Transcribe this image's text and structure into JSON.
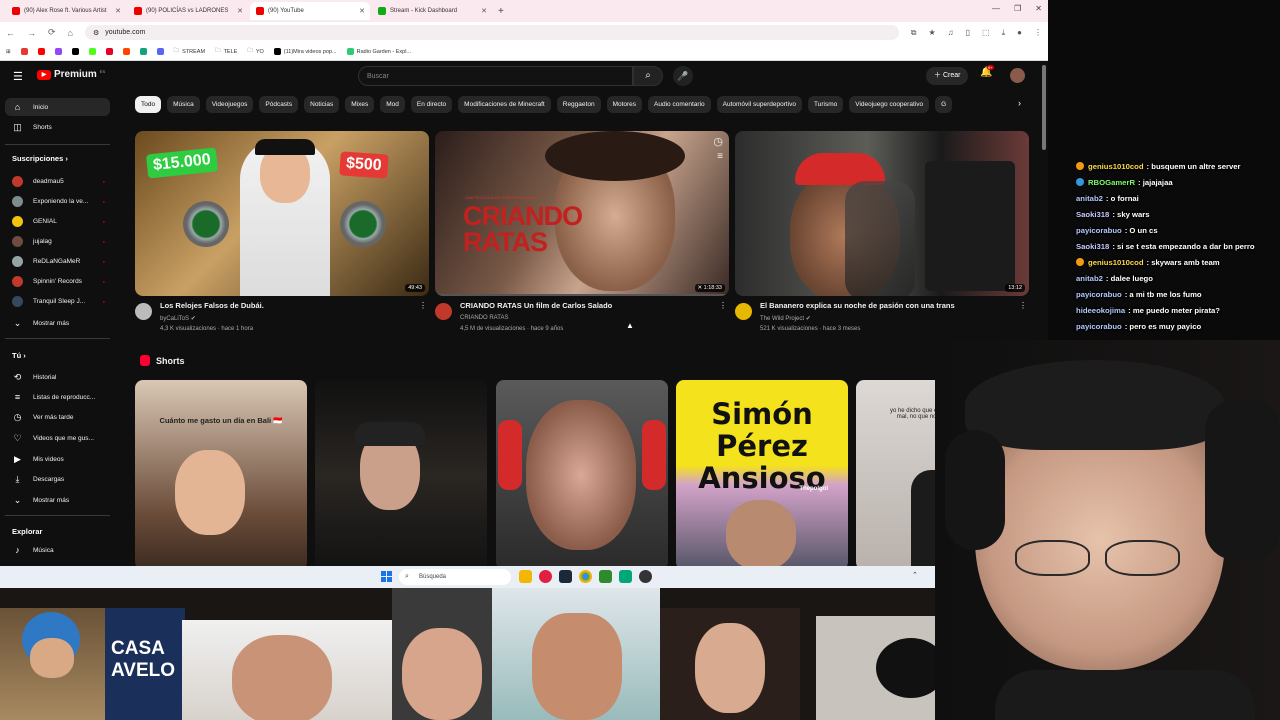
{
  "browser": {
    "tabs": [
      {
        "title": "(90) Alex Rose ft. Various Artist",
        "active": false
      },
      {
        "title": "(90) POLICÍAS vs LADRONES",
        "active": false
      },
      {
        "title": "(90) YouTube",
        "active": true
      },
      {
        "title": "Stream - Kick Dashboard",
        "active": false
      }
    ],
    "new_tab": "+",
    "url": "youtube.com",
    "bookmarks": [
      "STREAM",
      "TELE",
      "YO",
      "(11)Mira videos pop...",
      "Radio Garden - Expl..."
    ]
  },
  "youtube": {
    "logo_text": "Premium",
    "logo_sup": "ES",
    "search_placeholder": "Buscar",
    "create_label": "Crear",
    "notif_count": "9+",
    "sidebar": {
      "main": [
        {
          "label": "Inicio",
          "icon": "home-icon",
          "glyph": "⌂"
        },
        {
          "label": "Shorts",
          "icon": "shorts-icon",
          "glyph": "◫"
        }
      ],
      "subs_header": "Suscripciones",
      "subscriptions": [
        {
          "label": "deadmau5",
          "color": "#c0392b"
        },
        {
          "label": "Exponiendo la ve...",
          "color": "#7f8c8d"
        },
        {
          "label": "GENIAL",
          "color": "#f1c40f"
        },
        {
          "label": "jujalag",
          "color": "#6d4c41"
        },
        {
          "label": "ReDLaNGaMeR",
          "color": "#95a5a6"
        },
        {
          "label": "Spinnin' Records",
          "color": "#c0392b"
        },
        {
          "label": "Tranquil Sleep J...",
          "color": "#34495e"
        }
      ],
      "show_more": "Mostrar más",
      "you_header": "Tú",
      "you_items": [
        {
          "label": "Historial",
          "icon": "history-icon",
          "glyph": "⟲"
        },
        {
          "label": "Listas de reproducc...",
          "icon": "playlists-icon",
          "glyph": "≡"
        },
        {
          "label": "Ver más tarde",
          "icon": "watch-later-icon",
          "glyph": "◷"
        },
        {
          "label": "Videos que me gus...",
          "icon": "like-icon",
          "glyph": "♡"
        },
        {
          "label": "Mis videos",
          "icon": "my-videos-icon",
          "glyph": "▶"
        },
        {
          "label": "Descargas",
          "icon": "download-icon",
          "glyph": "⤓"
        },
        {
          "label": "Mostrar más",
          "icon": "chevron-down-icon",
          "glyph": "⌄"
        }
      ],
      "explore_header": "Explorar",
      "explore_items": [
        {
          "label": "Música",
          "icon": "music-icon",
          "glyph": "♪"
        }
      ]
    },
    "chips": [
      "Todo",
      "Música",
      "Videojuegos",
      "Pódcasts",
      "Noticias",
      "Mixes",
      "Mod",
      "En directo",
      "Modificaciones de Minecraft",
      "Reggaeton",
      "Motores",
      "Audio comentario",
      "Automóvil superdeportivo",
      "Turismo",
      "Videojuego cooperativo",
      "G"
    ],
    "videos": [
      {
        "title": "Los Relojes Falsos de Dubái.",
        "channel": "byCaLiToS",
        "meta": "4,3 K visualizaciones · hace 1 hora",
        "duration": "49:43",
        "badge_left": "$15.000",
        "badge_right": "$500"
      },
      {
        "title": "CRIANDO RATAS Un film de Carlos Salado",
        "channel": "CRIANDO RATAS",
        "meta": "4,5 M de visualizaciones · hace 9 años",
        "duration": "1:18:33",
        "overlay": "CRIANDO RATAS",
        "overlay_small": "UNA PELÍCULA DE CARLOS SALADO"
      },
      {
        "title": "El Bananero explica su noche de pasión con una trans",
        "channel": "The Wild Project",
        "meta": "521 K visualizaciones · hace 3 meses",
        "duration": "13:12"
      }
    ],
    "shorts_title": "Shorts",
    "shorts": [
      {
        "caption": "Cuánto me gasto un día en Bali 🇮🇩"
      },
      {
        "caption": ""
      },
      {
        "caption": ""
      },
      {
        "caption": "Simón Pérez Ansioso",
        "tag": "Thepolgol"
      },
      {
        "caption": "yo he dicho que es idiota y que me cae mal, no que no le tuviera ganas ..."
      }
    ]
  },
  "taskbar": {
    "search_placeholder": "Búsqueda"
  },
  "chat": [
    {
      "user": "genius1010cod",
      "text": ": busquem un altre server",
      "color": "#ffd94a",
      "badge": "#f39c12"
    },
    {
      "user": "RBOGamerR",
      "text": ": jajajajaa",
      "color": "#7cff6b",
      "badge": "#3498db"
    },
    {
      "user": "anitab2",
      "text": ": o fornai",
      "color": "#b3c8ff",
      "badge": ""
    },
    {
      "user": "Saoki318",
      "text": ": sky wars",
      "color": "#c7c9ff",
      "badge": ""
    },
    {
      "user": "payicorabuo",
      "text": ": O un cs",
      "color": "#b3c8ff",
      "badge": ""
    },
    {
      "user": "Saoki318",
      "text": ": si se t esta empezando a dar bn perro",
      "color": "#c7c9ff",
      "badge": ""
    },
    {
      "user": "genius1010cod",
      "text": ": skywars amb team",
      "color": "#ffd94a",
      "badge": "#f39c12"
    },
    {
      "user": "anitab2",
      "text": ": dalee luego",
      "color": "#b3c8ff",
      "badge": ""
    },
    {
      "user": "payicorabuo",
      "text": ": a mi tb me los fumo",
      "color": "#b3c8ff",
      "badge": ""
    },
    {
      "user": "hideeokojima",
      "text": ": me puedo meter pirata?",
      "color": "#b3c8ff",
      "badge": ""
    },
    {
      "user": "payicorabuo",
      "text": ": pero es muy payico",
      "color": "#b3c8ff",
      "badge": ""
    }
  ],
  "colors": {
    "yt_bg": "#0f0f0f",
    "accent_red": "#ff0000",
    "chip": "#272727"
  }
}
